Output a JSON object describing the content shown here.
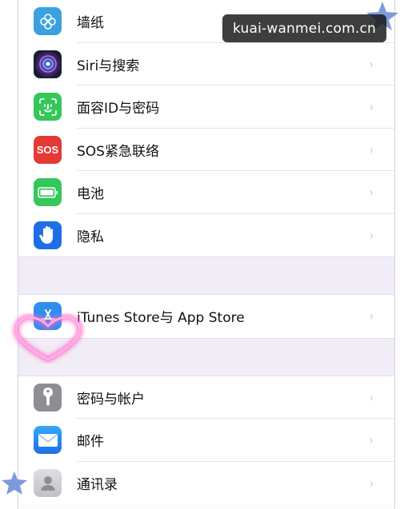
{
  "watermark": "kuai-wanmei.com.cn",
  "groups": [
    {
      "items": [
        {
          "label": "墙纸",
          "icon": "wallpaper-icon",
          "color": "#3aa1e0"
        },
        {
          "label": "Siri与搜索",
          "icon": "siri-icon",
          "color": "#1b1b2f"
        },
        {
          "label": "面容ID与密码",
          "icon": "faceid-icon",
          "color": "#34c759"
        },
        {
          "label": "SOS紧急联络",
          "icon": "sos-icon",
          "color": "#e53935"
        },
        {
          "label": "电池",
          "icon": "battery-icon",
          "color": "#34c759"
        },
        {
          "label": "隐私",
          "icon": "privacy-hand-icon",
          "color": "#1e6fe6"
        }
      ]
    },
    {
      "items": [
        {
          "label": "iTunes Store与 App Store",
          "icon": "app-store-icon",
          "color": "#2f8ef0"
        }
      ]
    },
    {
      "items": [
        {
          "label": "密码与帐户",
          "icon": "key-icon",
          "color": "#8e8e93"
        },
        {
          "label": "邮件",
          "icon": "mail-icon",
          "color": "#1f8ef1"
        },
        {
          "label": "通讯录",
          "icon": "contacts-icon",
          "color": "#c9c9cf"
        }
      ]
    }
  ],
  "chevron": "›"
}
